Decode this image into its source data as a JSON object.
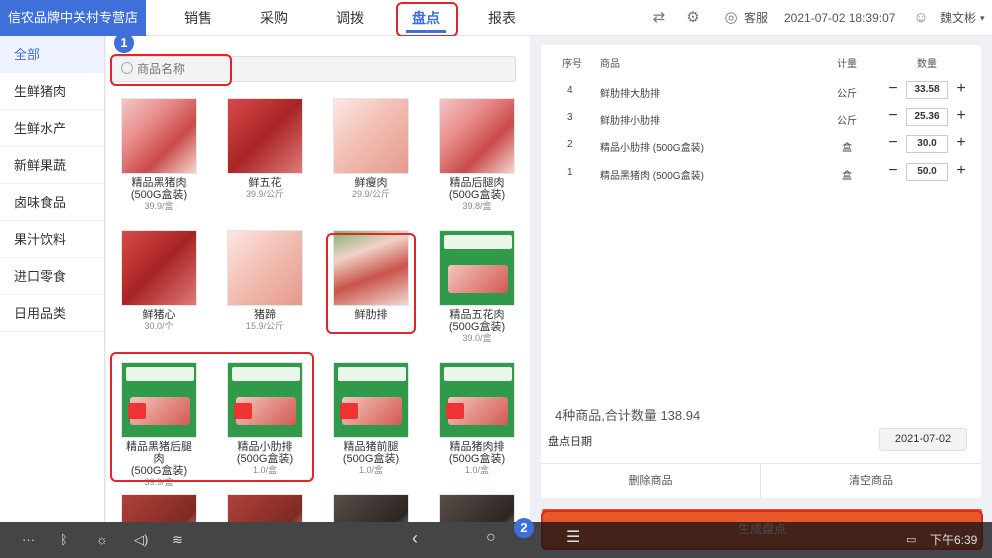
{
  "store": "信农品牌中关村专营店",
  "nav": [
    "销售",
    "采购",
    "调拨",
    "盘点",
    "报表"
  ],
  "top": {
    "service": "客服",
    "datetime": "2021-07-02 18:39:07",
    "user": "魏文彬"
  },
  "sidebar": [
    "全部",
    "生鲜猪肉",
    "生鲜水产",
    "新鲜果蔬",
    "卤味食品",
    "果汁饮料",
    "进口零食",
    "日用品类"
  ],
  "search": {
    "placeholder": "商品名称"
  },
  "products": [
    {
      "name": "精品黑猪肉\n(500G盒装)",
      "price": "39.9/盒"
    },
    {
      "name": "鲜五花",
      "price": "39.9/公斤"
    },
    {
      "name": "鲜瘦肉",
      "price": "29.9/公斤"
    },
    {
      "name": "精品后腿肉\n(500G盒装)",
      "price": "39.8/盒"
    },
    {
      "name": "鲜猪心",
      "price": "30.0/个"
    },
    {
      "name": "猪蹄",
      "price": "15.9/公斤"
    },
    {
      "name": "鲜肋排",
      "price": ""
    },
    {
      "name": "精品五花肉\n(500G盒装)",
      "price": "39.0/盒"
    },
    {
      "name": "精品黑猪后腿肉\n(500G盒装)",
      "price": "39.9/盒"
    },
    {
      "name": "精品小肋排\n(500G盒装)",
      "price": "1.0/盒"
    },
    {
      "name": "精品猪前腿\n(500G盒装)",
      "price": "1.0/盒"
    },
    {
      "name": "精品猪肉排\n(500G盒装)",
      "price": "1.0/盒"
    }
  ],
  "table": {
    "headers": [
      "序号",
      "商品",
      "计量",
      "数量"
    ],
    "rows": [
      {
        "no": "4",
        "name": "鲜肋排大肋排",
        "unit": "公斤",
        "qty": "33.58"
      },
      {
        "no": "3",
        "name": "鲜肋排小肋排",
        "unit": "公斤",
        "qty": "25.36"
      },
      {
        "no": "2",
        "name": "精品小肋排 (500G盒装)",
        "unit": "盒",
        "qty": "30.0"
      },
      {
        "no": "1",
        "name": "精品黑猪肉 (500G盒装)",
        "unit": "盒",
        "qty": "50.0"
      }
    ]
  },
  "summary": "4种商品,合计数量 138.94",
  "date_label": "盘点日期",
  "date_value": "2021-07-02",
  "actions": {
    "delete": "删除商品",
    "clear": "清空商品",
    "generate": "生成盘点"
  },
  "badges": [
    "1",
    "2"
  ],
  "system": {
    "time": "下午6:39",
    "more": "···"
  },
  "colors": {
    "accent": "#3f6fd8",
    "generate": "#e8592a",
    "highlight": "#e0262a"
  }
}
